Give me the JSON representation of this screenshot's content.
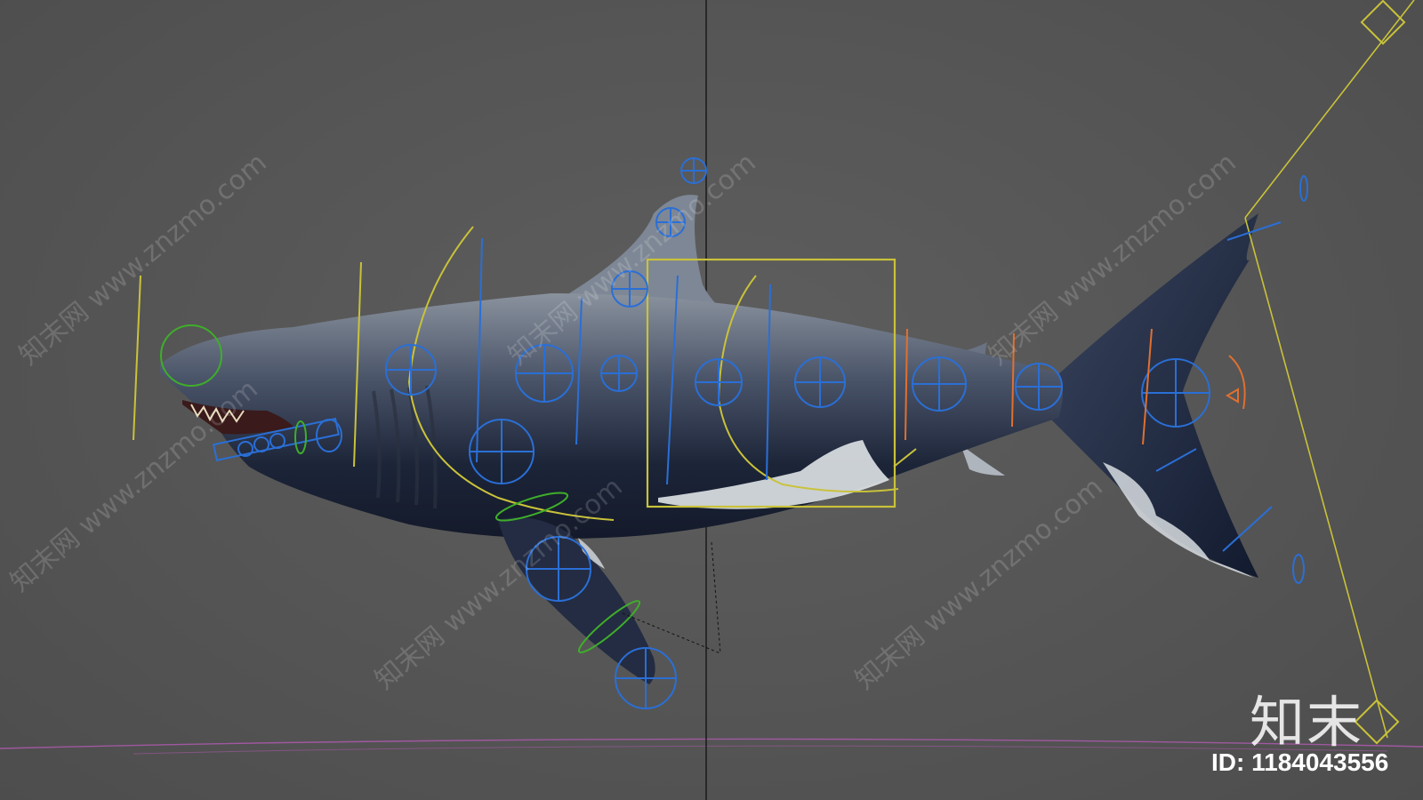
{
  "watermark": {
    "text": "知末网 www.znzmo.com"
  },
  "brand": {
    "logo_text": "知末",
    "id_label": "ID: 1184043556"
  },
  "colors": {
    "background": "#565656",
    "control_blue": "#2a6fd6",
    "control_yellow": "#c9c23a",
    "control_green": "#3fae2a",
    "control_orange": "#e07030",
    "grid_magenta": "#b45ab4"
  }
}
